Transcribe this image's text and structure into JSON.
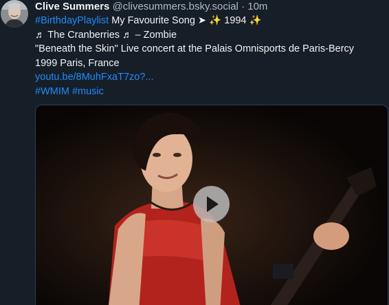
{
  "post": {
    "author": {
      "display_name": "Clive Summers",
      "handle": "@clivesummers.bsky.social",
      "separator": "·",
      "time": "10m"
    },
    "line1": {
      "hashtag": "#BirthdayPlaylist",
      "text": " My Favourite Song ➤ ",
      "sparkle_left": "✨",
      "year": " 1994 ",
      "sparkle_right": "✨"
    },
    "line2": "♬ The Cranberries ♬ – Zombie",
    "line3": "\"Beneath the Skin\" Live concert at the Palais Omnisports de Paris-Bercy",
    "line4": "1999 Paris, France",
    "link": "youtu.be/8MuhFxaT7zo?...",
    "tags": [
      "#WMIM",
      "#music"
    ]
  },
  "icons": {
    "play": "play-icon",
    "avatar": "avatar-image"
  }
}
